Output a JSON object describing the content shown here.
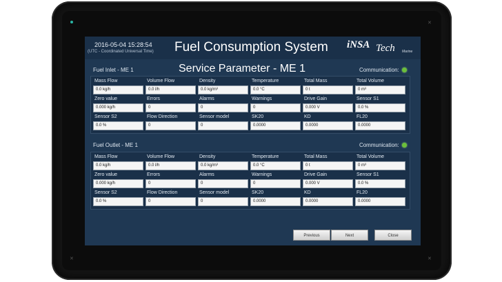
{
  "header": {
    "datetime": "2016-05-04 15:28:54",
    "timezone": "(UTC - Coordinated Universal Time)",
    "title": "Fuel Consumption System",
    "logo": {
      "main": "iNSA",
      "tech": "Tech",
      "sub": "Marine"
    }
  },
  "page_title": "Service Parameter - ME 1",
  "sections": [
    {
      "label": "Fuel Inlet - ME 1",
      "comm_label": "Communication:",
      "comm_status_color": "#6bbf3a",
      "cells": [
        {
          "label": "Mass Flow",
          "value": "0.0 kg/h"
        },
        {
          "label": "Volume Flow",
          "value": "0.0 l/h"
        },
        {
          "label": "Density",
          "value": "0.0 kg/m³"
        },
        {
          "label": "Temperature",
          "value": "0.0 °C"
        },
        {
          "label": "Total Mass",
          "value": "0 t"
        },
        {
          "label": "Total Volume",
          "value": "0 m³"
        },
        {
          "label": "Zero value",
          "value": "0.000 kg/h"
        },
        {
          "label": "Errors",
          "value": "0"
        },
        {
          "label": "Alarms",
          "value": "0"
        },
        {
          "label": "Warnings",
          "value": "0"
        },
        {
          "label": "Drive Gain",
          "value": "0.000 V"
        },
        {
          "label": "Sensor S1",
          "value": "0.0 %"
        },
        {
          "label": "Sensor S2",
          "value": "0.0 %"
        },
        {
          "label": "Flow Direction",
          "value": "0"
        },
        {
          "label": "Sensor model",
          "value": "0"
        },
        {
          "label": "SK20",
          "value": "0.0000"
        },
        {
          "label": "KD",
          "value": "0.0000"
        },
        {
          "label": "FL20",
          "value": "0.0000"
        }
      ]
    },
    {
      "label": "Fuel Outlet - ME 1",
      "comm_label": "Communication:",
      "comm_status_color": "#6bbf3a",
      "cells": [
        {
          "label": "Mass Flow",
          "value": "0.0 kg/h"
        },
        {
          "label": "Volume Flow",
          "value": "0.0 l/h"
        },
        {
          "label": "Density",
          "value": "0.0 kg/m³"
        },
        {
          "label": "Temperature",
          "value": "0.0 °C"
        },
        {
          "label": "Total Mass",
          "value": "0 t"
        },
        {
          "label": "Total Volume",
          "value": "0 m³"
        },
        {
          "label": "Zero value",
          "value": "0.000 kg/h"
        },
        {
          "label": "Errors",
          "value": "0"
        },
        {
          "label": "Alarms",
          "value": "0"
        },
        {
          "label": "Warnings",
          "value": "0"
        },
        {
          "label": "Drive Gain",
          "value": "0.000 V"
        },
        {
          "label": "Sensor S1",
          "value": "0.0 %"
        },
        {
          "label": "Sensor S2",
          "value": "0.0 %"
        },
        {
          "label": "Flow Direction",
          "value": "0"
        },
        {
          "label": "Sensor model",
          "value": "0"
        },
        {
          "label": "SK20",
          "value": "0.0000"
        },
        {
          "label": "KD",
          "value": "0.0000"
        },
        {
          "label": "FL20",
          "value": "0.0000"
        }
      ]
    }
  ],
  "buttons": {
    "previous": "Previous",
    "next": "Next",
    "close": "Close"
  },
  "colors": {
    "screen_bg": "#1f3853",
    "panel_bg": "#1a3049",
    "status_ok": "#6bbf3a"
  }
}
